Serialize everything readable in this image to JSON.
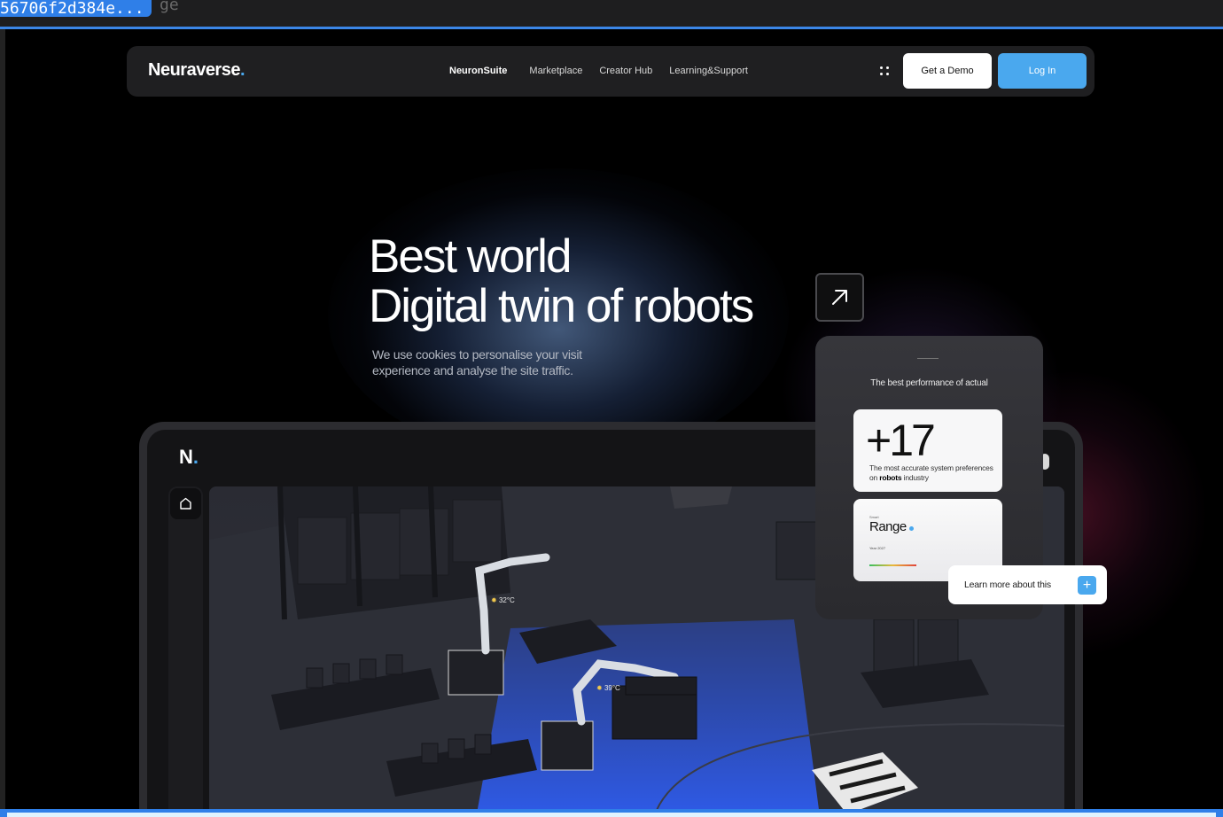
{
  "browser": {
    "file_tag": "56706f2d384e...",
    "file_tag_suffix": "ge"
  },
  "nav": {
    "logo": "Neuraverse",
    "logo_dot": ".",
    "links": [
      "NeuronSuite",
      "Marketplace",
      "Creator Hub",
      "Learning&Support"
    ],
    "active_link": "NeuronSuite",
    "demo_label": "Get a Demo",
    "login_label": "Log In"
  },
  "hero": {
    "title_line1": "Best world",
    "title_line2": "Digital twin of robots",
    "subtitle": "We use cookies to personalise your visit experience and analyse the site traffic."
  },
  "dashboard": {
    "logo": "N",
    "logo_dot": ".",
    "temperatures": [
      "32°C",
      "39°C"
    ]
  },
  "performance_card": {
    "title": "The best performance of actual",
    "stat_value": "+17",
    "stat_desc_before": "The most accurate system preferences on ",
    "stat_desc_bold": "robots",
    "stat_desc_after": " industry",
    "range_small": "Smart",
    "range_title": "Range",
    "range_year": "Year 2027"
  },
  "learn_more": {
    "label": "Learn more about this",
    "button": "+"
  },
  "colors": {
    "accent": "#4aa8ee",
    "nav_bg": "#1f1f21",
    "page_bg": "#000000"
  }
}
